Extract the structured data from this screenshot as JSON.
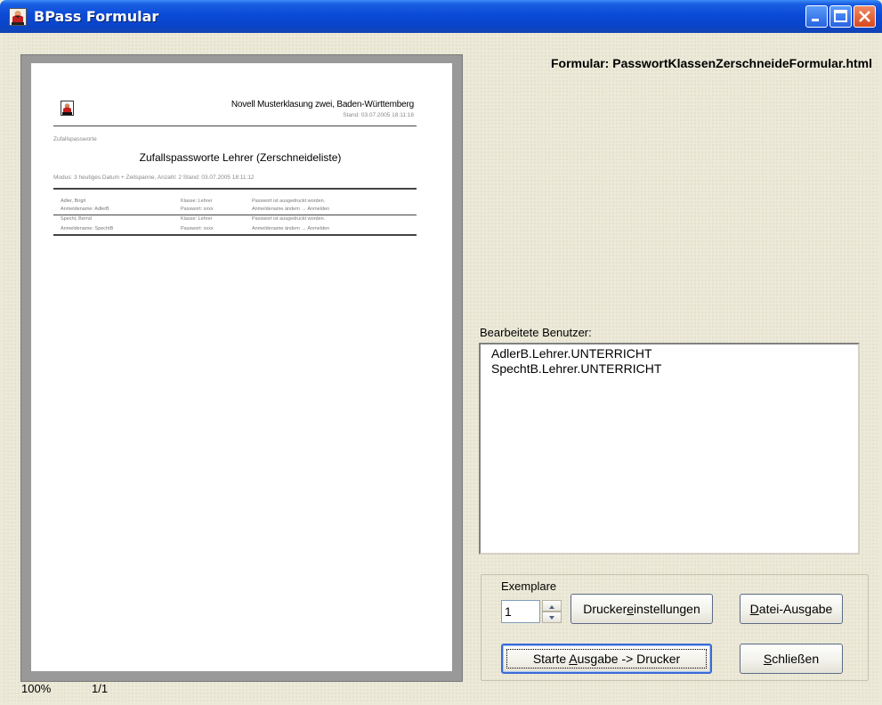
{
  "window": {
    "title": "BPass Formular",
    "controls": {
      "minimize": "minimize-icon",
      "maximize": "maximize-icon",
      "close": "close-icon"
    }
  },
  "preview": {
    "org_line": "Novell Musterklasung zwei, Baden-Württemberg",
    "stand_line": "Stand: 03.07.2005 18:11:16",
    "subtitle": "Zufallspassworte",
    "doc_title": "Zufallspassworte Lehrer (Zerschneideliste)",
    "info_line": "Modus: 3 heutiges Datum + Zeitspanne, Anzahl: 2  Stand: 03.07.2005 18:11:12",
    "rows": [
      {
        "name": "Adler, Birgit",
        "klasse": "Klasse: Lehrer",
        "note": "Passwort ist ausgedruckt worden.",
        "login": "Anmeldename: AdlerB",
        "pw": "Passwort: xxxx",
        "note2": "Anmeldename ändern → Anmelden"
      },
      {
        "name": "Specht, Bernd",
        "klasse": "Klasse: Lehrer",
        "note": "Passwort ist ausgedruckt worden.",
        "login": "Anmeldename: SpechtB",
        "pw": "Passwort: xxxx",
        "note2": "Anmeldename ändern → Anmelden"
      }
    ]
  },
  "formular": {
    "label": "Formular:",
    "file": "PasswortKlassenZerschneideFormular.html"
  },
  "users": {
    "label": "Bearbeitete Benutzer:",
    "items": [
      "AdlerB.Lehrer.UNTERRICHT",
      "SpechtB.Lehrer.UNTERRICHT"
    ]
  },
  "controls": {
    "exemplare_label": "Exemplare",
    "exemplare_value": "1",
    "druckereinstellungen_pre": "Drucker",
    "druckereinstellungen_u": "e",
    "druckereinstellungen_post": "instellungen",
    "datei_u": "D",
    "datei_post": "atei-Ausgabe",
    "starte_pre": "Starte ",
    "starte_u": "A",
    "starte_post": "usgabe -> Drucker",
    "schliessen_u": "S",
    "schliessen_post": "chließen"
  },
  "status": {
    "zoom": "100%",
    "pages": "1/1"
  },
  "colors": {
    "titlebar": "#0b4ad7",
    "close": "#d6481e",
    "dialog_bg": "#ece9d8",
    "preview_frame": "#999999"
  }
}
